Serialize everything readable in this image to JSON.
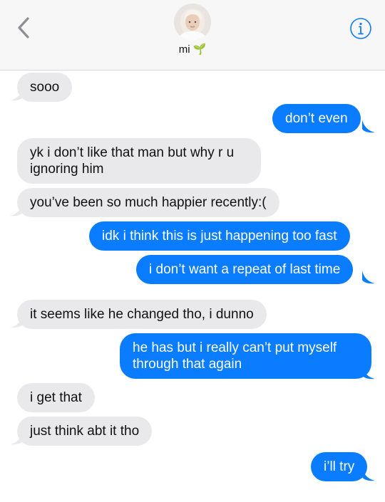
{
  "header": {
    "contact_name": "mi",
    "name_emoji": "🌱"
  },
  "messages": [
    {
      "from": "them",
      "text": "sooo"
    },
    {
      "from": "me",
      "text": "don’t even"
    },
    {
      "from": "them",
      "text": "yk i don’t like that man but why r u ignoring him"
    },
    {
      "from": "them",
      "text": "you’ve been so much happier recently:("
    },
    {
      "from": "me",
      "text": "idk i think this is just happening too fast"
    },
    {
      "from": "me",
      "text": "i don’t want a repeat of last time"
    },
    {
      "from": "them",
      "text": "it seems like he changed tho, i dunno"
    },
    {
      "from": "me",
      "text": "he has but i really can’t put myself through that again"
    },
    {
      "from": "them",
      "text": "i get that"
    },
    {
      "from": "them",
      "text": "just think abt it tho"
    },
    {
      "from": "me",
      "text": "i’ll try"
    }
  ],
  "colors": {
    "outgoing": "#0a7cff",
    "incoming": "#e9e9eb",
    "accent": "#0a7cff"
  },
  "icons": {
    "back": "chevron-left-icon",
    "info": "info-icon"
  }
}
